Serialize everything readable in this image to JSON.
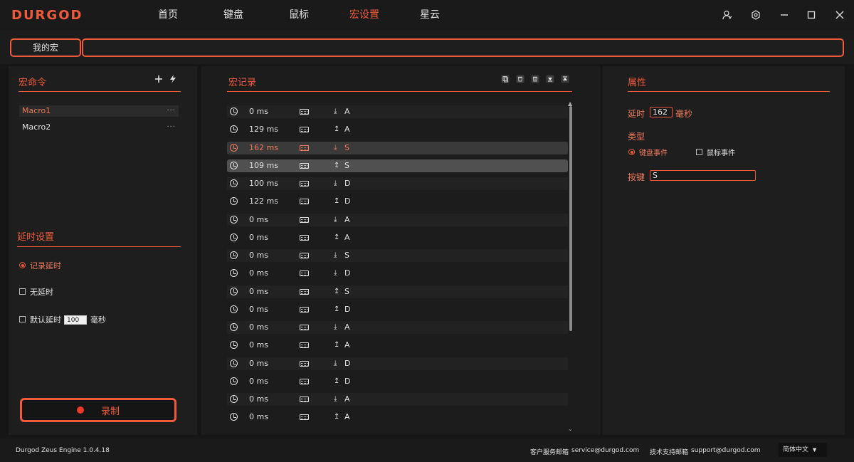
{
  "app": {
    "logo": "DURGOD"
  },
  "nav": [
    {
      "label": "首页",
      "active": false
    },
    {
      "label": "键盘",
      "active": false
    },
    {
      "label": "鼠标",
      "active": false
    },
    {
      "label": "宏设置",
      "active": true
    },
    {
      "label": "星云",
      "active": false
    }
  ],
  "window_controls": {
    "user": "user-icon",
    "settings": "gear-icon",
    "minimize": "minimize-icon",
    "maximize": "maximize-icon",
    "close": "close-icon"
  },
  "topbar": {
    "my_macro": "我的宏",
    "macro_name_value": ""
  },
  "macro_commands": {
    "title": "宏命令",
    "add_icon": "plus-icon",
    "import_icon": "lightning-icon",
    "items": [
      {
        "name": "Macro1",
        "selected": true,
        "more": "···"
      },
      {
        "name": "Macro2",
        "selected": false,
        "more": "···"
      }
    ]
  },
  "delay_settings": {
    "title": "延时设置",
    "record_delay": "记录延时",
    "no_delay": "无延时",
    "default_delay": "默认延时",
    "default_value": "100",
    "unit": "毫秒"
  },
  "record_button": "录制",
  "macro_record": {
    "title": "宏记录",
    "tool_icons": [
      "copy-icon",
      "clear-icon",
      "delete-icon",
      "move-down-icon",
      "move-up-icon"
    ],
    "rows": [
      {
        "time": "0 ms",
        "dir": "down",
        "key": "A"
      },
      {
        "time": "129 ms",
        "dir": "up",
        "key": "A"
      },
      {
        "time": "162 ms",
        "dir": "down",
        "key": "S"
      },
      {
        "time": "109 ms",
        "dir": "up",
        "key": "S"
      },
      {
        "time": "100 ms",
        "dir": "down",
        "key": "D"
      },
      {
        "time": "122 ms",
        "dir": "up",
        "key": "D"
      },
      {
        "time": "0 ms",
        "dir": "down",
        "key": "A"
      },
      {
        "time": "0 ms",
        "dir": "up",
        "key": "A"
      },
      {
        "time": "0 ms",
        "dir": "down",
        "key": "S"
      },
      {
        "time": "0 ms",
        "dir": "down",
        "key": "D"
      },
      {
        "time": "0 ms",
        "dir": "up",
        "key": "S"
      },
      {
        "time": "0 ms",
        "dir": "up",
        "key": "D"
      },
      {
        "time": "0 ms",
        "dir": "down",
        "key": "A"
      },
      {
        "time": "0 ms",
        "dir": "up",
        "key": "A"
      },
      {
        "time": "0 ms",
        "dir": "down",
        "key": "D"
      },
      {
        "time": "0 ms",
        "dir": "up",
        "key": "D"
      },
      {
        "time": "0 ms",
        "dir": "down",
        "key": "A"
      },
      {
        "time": "0 ms",
        "dir": "up",
        "key": "A"
      }
    ]
  },
  "properties": {
    "title": "属性",
    "delay_label": "延时",
    "delay_value": "162",
    "delay_unit": "毫秒",
    "type_label": "类型",
    "keyboard_event": "键盘事件",
    "mouse_event": "鼠标事件",
    "key_label": "按键",
    "key_value": "S"
  },
  "footer": {
    "version": "Durgod Zeus Engine 1.0.4.18",
    "service_label": "客户服务邮箱",
    "service_email": "service@durgod.com",
    "support_label": "技术支持邮箱",
    "support_email": "support@durgod.com",
    "language": "简体中文"
  },
  "colors": {
    "accent": "#ee5a3a",
    "background": "#161616",
    "panel": "#1e1e1e"
  }
}
